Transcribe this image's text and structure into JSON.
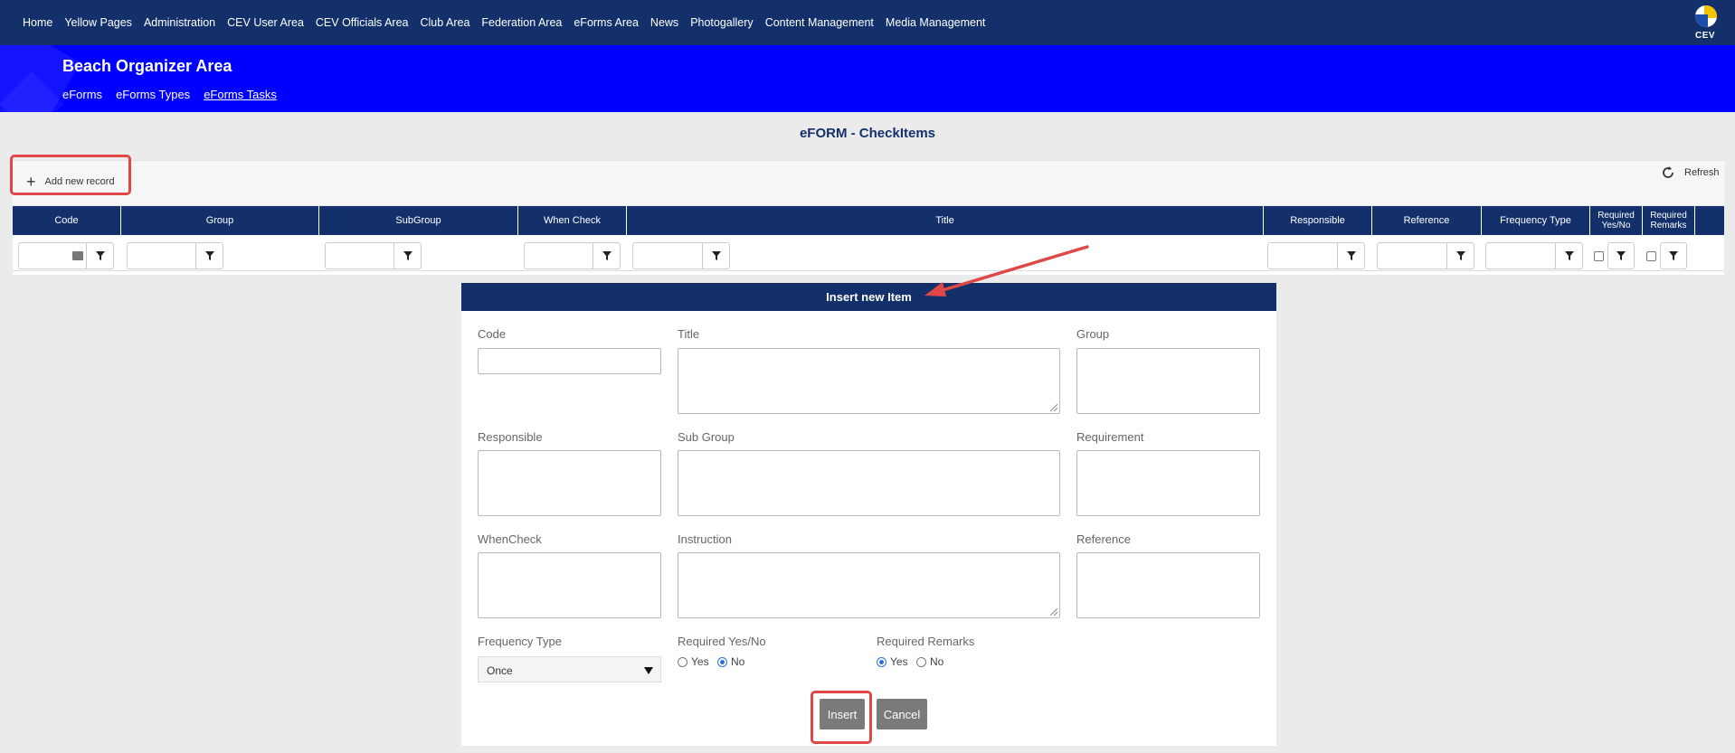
{
  "topnav": {
    "links": [
      "Home",
      "Yellow Pages",
      "Administration",
      "CEV User Area",
      "CEV Officials Area",
      "Club Area",
      "Federation Area",
      "eForms Area",
      "News",
      "Photogallery",
      "Content Management",
      "Media Management"
    ],
    "logo_text": "CEV"
  },
  "subheader": {
    "title": "Beach Organizer Area",
    "links": [
      "eForms",
      "eForms Types",
      "eForms Tasks"
    ]
  },
  "page_title": "eFORM - CheckItems",
  "toolbar": {
    "add_label": "Add new record",
    "refresh_label": "Refresh"
  },
  "grid": {
    "columns": [
      "Code",
      "Group",
      "SubGroup",
      "When Check",
      "Title",
      "Responsible",
      "Reference",
      "Frequency Type",
      "Required Yes/No",
      "Required Remarks"
    ]
  },
  "form": {
    "header": "Insert new Item",
    "labels": {
      "code": "Code",
      "title": "Title",
      "group": "Group",
      "responsible": "Responsible",
      "sub_group": "Sub Group",
      "requirement": "Requirement",
      "whencheck": "WhenCheck",
      "instruction": "Instruction",
      "reference": "Reference",
      "frequency_type": "Frequency Type",
      "required_yes_no": "Required Yes/No",
      "required_remarks": "Required Remarks"
    },
    "frequency_value": "Once",
    "radio_yes": "Yes",
    "radio_no": "No",
    "required_yes_no_selected": "No",
    "required_remarks_selected": "Yes",
    "insert_label": "Insert",
    "cancel_label": "Cancel"
  },
  "colors": {
    "navy": "#13306b",
    "blue": "#0000ff",
    "highlight": "#e04848"
  }
}
